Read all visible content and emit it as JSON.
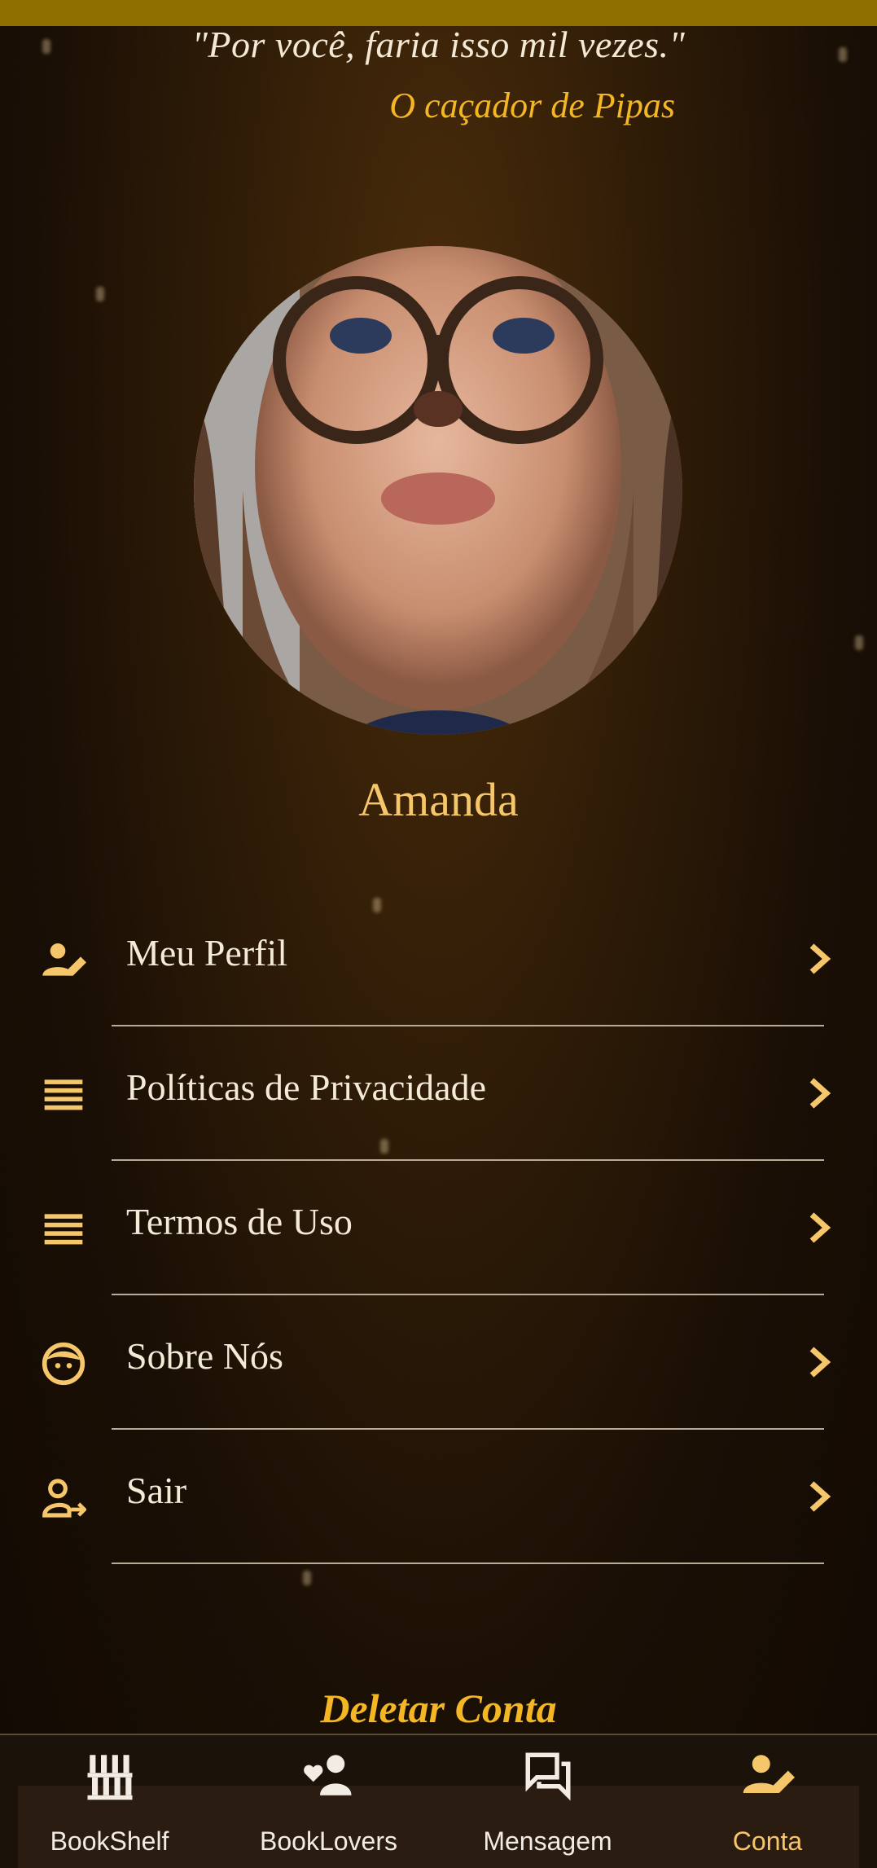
{
  "quote": {
    "text": "\"Por você, faria isso mil vezes.\"",
    "author": "O caçador de Pipas"
  },
  "profile": {
    "name": "Amanda",
    "avatar_icon": "profile-photo"
  },
  "menu": {
    "items": [
      {
        "label": "Meu Perfil",
        "icon": "person-edit-icon"
      },
      {
        "label": "Políticas de Privacidade",
        "icon": "lines-icon"
      },
      {
        "label": "Termos de Uso",
        "icon": "lines-icon"
      },
      {
        "label": "Sobre Nós",
        "icon": "face-icon"
      },
      {
        "label": "Sair",
        "icon": "person-logout-icon"
      }
    ]
  },
  "delete_account": "Deletar Conta",
  "bottom_nav": {
    "items": [
      {
        "label": "BookShelf",
        "icon": "bookshelf-icon",
        "active": false
      },
      {
        "label": "BookLovers",
        "icon": "people-heart-icon",
        "active": false
      },
      {
        "label": "Mensagem",
        "icon": "chat-icon",
        "active": false
      },
      {
        "label": "Conta",
        "icon": "person-edit-icon",
        "active": true
      }
    ]
  },
  "colors": {
    "accent": "#f4b623",
    "name_color": "#f5c66a",
    "top_bar": "#8f6f00"
  }
}
